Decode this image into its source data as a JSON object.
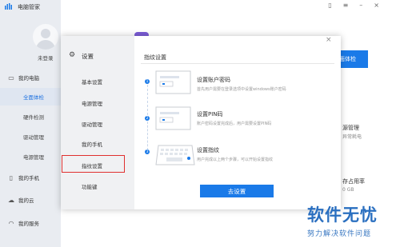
{
  "app": {
    "title": "电脑管家"
  },
  "user": {
    "login_label": "未登录"
  },
  "sidebar": {
    "items": [
      {
        "label": "我的电脑",
        "icon": "laptop-icon"
      },
      {
        "label": "我的手机",
        "icon": "phone-icon"
      },
      {
        "label": "我的云",
        "icon": "cloud-icon"
      },
      {
        "label": "我的服务",
        "icon": "headset-icon"
      }
    ],
    "sub_items": [
      "全面体检",
      "硬件检测",
      "驱动管理",
      "电源管理"
    ]
  },
  "background": {
    "exam_button": "面体检",
    "power_title": "源管理",
    "power_sub": "异常耗电",
    "storage_title": "存占用率",
    "storage_sub": "0 GB"
  },
  "dialog": {
    "title": "设置",
    "nav": [
      "基本设置",
      "电源管理",
      "驱动管理",
      "我的手机",
      "指纹设置",
      "功能键"
    ],
    "active_nav": "指纹设置",
    "panel_title": "指纹设置",
    "steps": [
      {
        "num": "1",
        "title": "设置账户密码",
        "desc": "首先用户需要在登录选项中设置windows账户密码"
      },
      {
        "num": "2",
        "title": "设置PIN码",
        "desc": "账户密码设置完成后，用户需要设置PIN码"
      },
      {
        "num": "3",
        "title": "设置指纹",
        "desc": "用户完成以上两个步骤，可以开始设置指纹"
      }
    ],
    "go_button": "去设置",
    "close_symbol": "×"
  },
  "watermark": {
    "main": "软件无忧",
    "sub": "努力解决软件问题"
  },
  "colors": {
    "accent": "#1a7ae8",
    "highlight": "#e0302f",
    "sidebar": "#e9ecf1"
  }
}
